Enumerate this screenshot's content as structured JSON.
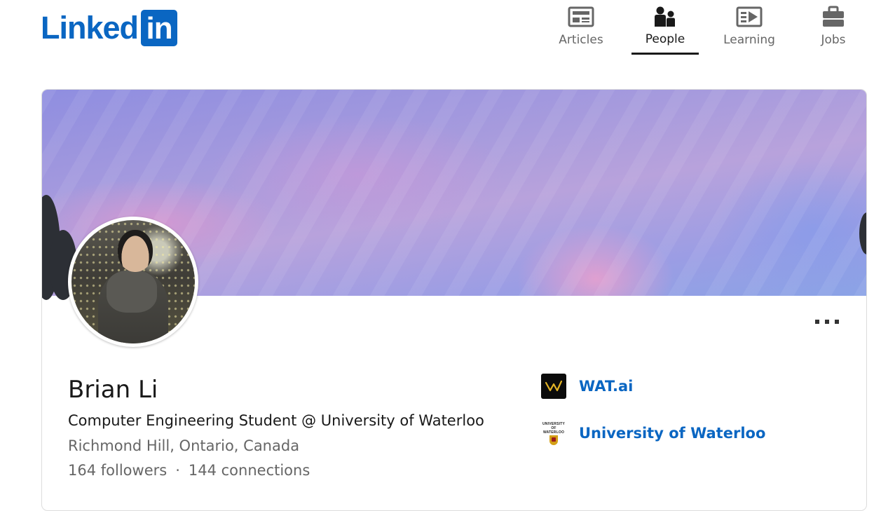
{
  "brand": {
    "word": "Linked",
    "box": "in",
    "color": "#0a66c2"
  },
  "nav": {
    "items": [
      {
        "label": "Articles",
        "icon": "articles-icon",
        "active": false
      },
      {
        "label": "People",
        "icon": "people-icon",
        "active": true
      },
      {
        "label": "Learning",
        "icon": "learning-icon",
        "active": false
      },
      {
        "label": "Jobs",
        "icon": "jobs-icon",
        "active": false
      }
    ]
  },
  "profile": {
    "name": "Brian Li",
    "headline": "Computer Engineering Student @ University of Waterloo",
    "location": "Richmond Hill, Ontario, Canada",
    "followers": "164 followers",
    "separator": "·",
    "connections": "144 connections",
    "more_icon": "ellipsis-icon"
  },
  "organizations": [
    {
      "name": "WAT.ai",
      "logo": "watai-logo"
    },
    {
      "name": "University of Waterloo",
      "logo": "uwaterloo-logo",
      "logo_text": "UNIVERSITY OF WATERLOO"
    }
  ],
  "colors": {
    "link": "#0a66c2",
    "text": "#191919",
    "muted": "#666666"
  }
}
